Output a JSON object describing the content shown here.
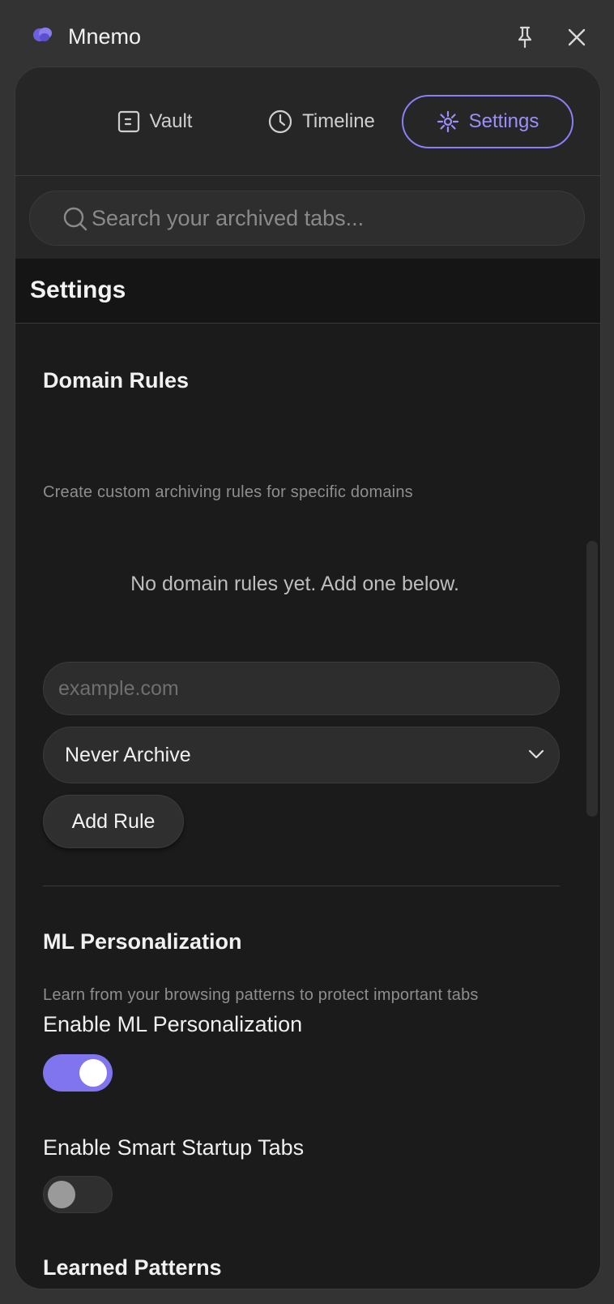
{
  "window": {
    "title": "Mnemo"
  },
  "tabs": [
    {
      "label": "Vault",
      "icon": "vault-icon"
    },
    {
      "label": "Timeline",
      "icon": "clock-icon"
    },
    {
      "label": "Settings",
      "icon": "settings-icon",
      "active": true
    }
  ],
  "search": {
    "placeholder": "Search your archived tabs..."
  },
  "settings": {
    "title": "Settings",
    "domain_rules": {
      "title": "Domain Rules",
      "description": "Create custom archiving rules for specific domains",
      "empty_message": "No domain rules yet. Add one below.",
      "domain_placeholder": "example.com",
      "action_selected": "Never Archive",
      "add_button": "Add Rule"
    },
    "ml": {
      "title": "ML Personalization",
      "description": "Learn from your browsing patterns to protect important tabs",
      "toggles": [
        {
          "label": "Enable ML Personalization",
          "on": true
        },
        {
          "label": "Enable Smart Startup Tabs",
          "on": false
        }
      ]
    },
    "learned_patterns": {
      "title": "Learned Patterns"
    }
  },
  "colors": {
    "accent": "#8a7ff5",
    "panel_bg": "#1b1b1b",
    "chrome_bg": "#333333"
  }
}
